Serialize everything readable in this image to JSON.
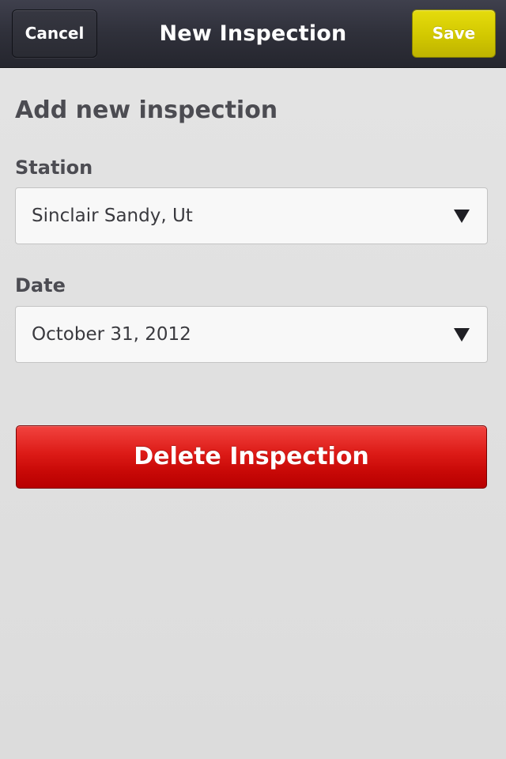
{
  "header": {
    "title": "New Inspection",
    "cancel_label": "Cancel",
    "save_label": "Save",
    "save_color": "#d2c800"
  },
  "form": {
    "heading": "Add new inspection",
    "station": {
      "label": "Station",
      "value": "Sinclair Sandy, Ut",
      "icon": "dropdown-arrow-icon"
    },
    "date": {
      "label": "Date",
      "value": "October 31, 2012",
      "icon": "dropdown-arrow-icon"
    }
  },
  "actions": {
    "delete_label": "Delete Inspection",
    "delete_color": "#c70806"
  }
}
